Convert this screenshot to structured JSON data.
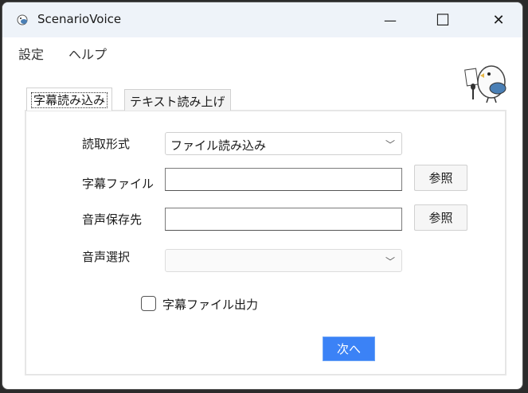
{
  "window": {
    "title": "ScenarioVoice",
    "minimize": "—",
    "maximize": "☐",
    "close": "✕"
  },
  "menu": [
    "設定",
    "ヘルプ"
  ],
  "tabs": [
    "字幕読み込み",
    "テキスト読み上げ"
  ],
  "form": {
    "read_format_label": "読取形式",
    "read_format_value": "ファイル読み込み",
    "subtitle_file_label": "字幕ファイル",
    "subtitle_file_value": "",
    "browse_label": "参照",
    "audio_dest_label": "音声保存先",
    "audio_dest_value": "",
    "voice_select_label": "音声選択",
    "voice_select_value": "",
    "subtitle_output_label": "字幕ファイル出力",
    "next_label": "次へ"
  },
  "colors": {
    "accent": "#3b82f6"
  }
}
